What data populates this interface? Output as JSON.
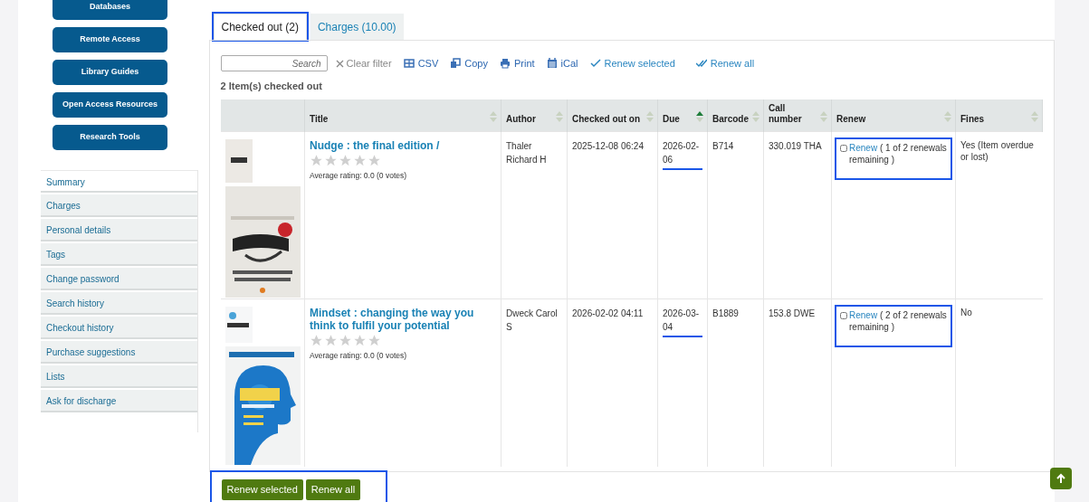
{
  "sidebar": {
    "buttons": [
      "Databases",
      "Remote Access",
      "Library Guides",
      "Open Access Resources",
      "Research Tools"
    ],
    "menu": [
      {
        "label": "Summary",
        "selected": true
      },
      {
        "label": "Charges",
        "selected": false
      },
      {
        "label": "Personal details",
        "selected": false
      },
      {
        "label": "Tags",
        "selected": false
      },
      {
        "label": "Change password",
        "selected": false
      },
      {
        "label": "Search history",
        "selected": false
      },
      {
        "label": "Checkout history",
        "selected": false
      },
      {
        "label": "Purchase suggestions",
        "selected": false
      },
      {
        "label": "Lists",
        "selected": false
      },
      {
        "label": "Ask for discharge",
        "selected": false
      }
    ]
  },
  "tabs": [
    {
      "label": "Checked out (2)",
      "selected": true,
      "highlighted": true
    },
    {
      "label": "Charges (10.00)",
      "selected": false,
      "highlighted": false
    }
  ],
  "toolbar": {
    "search": {
      "placeholder": "Search"
    },
    "clear_filter": "Clear filter",
    "actions": [
      {
        "kind": "csv",
        "label": "CSV"
      },
      {
        "kind": "copy",
        "label": "Copy"
      },
      {
        "kind": "print",
        "label": "Print"
      },
      {
        "kind": "ical",
        "label": "iCal"
      },
      {
        "kind": "renew-selected",
        "label": "Renew selected"
      },
      {
        "kind": "renew-all",
        "label": "Renew all"
      }
    ]
  },
  "summary": "2 Item(s) checked out",
  "table": {
    "columns": [
      {
        "label": "Title",
        "sorted_ascending": false
      },
      {
        "label": "Author",
        "sorted_ascending": false
      },
      {
        "label": "Checked out on",
        "sorted_ascending": false
      },
      {
        "label": "Due",
        "sorted_ascending": true
      },
      {
        "label": "Barcode",
        "sorted_ascending": false
      },
      {
        "label": "Call number",
        "sorted_ascending": false
      },
      {
        "label": "Renew",
        "sorted_ascending": false
      },
      {
        "label": "Fines",
        "sorted_ascending": false
      }
    ],
    "rows": [
      {
        "title": "Nudge : the final edition /",
        "stars": 0,
        "rating": "Average rating: 0.0 (0 votes)",
        "author": "Thaler Richard H",
        "checked_out_on": "2025-12-08 06:24",
        "due": "2026-02-06",
        "due_highlighted": true,
        "barcode": "B714",
        "call_number": "330.019 THA",
        "renew": {
          "checked": false,
          "link": "Renew",
          "note": "( 1 of 2 renewals remaining )",
          "highlighted": true
        },
        "fines": "Yes (Item overdue or lost)"
      },
      {
        "title": "Mindset : changing the way you think to fulfil your potential",
        "stars": 0,
        "rating": "Average rating: 0.0 (0 votes)",
        "author": "Dweck Carol S",
        "checked_out_on": "2026-02-02 04:11",
        "due": "2026-03-04",
        "due_highlighted": true,
        "barcode": "B1889",
        "call_number": "153.8 DWE",
        "renew": {
          "checked": false,
          "link": "Renew",
          "note": "( 2 of 2 renewals remaining )",
          "highlighted": true
        },
        "fines": "No"
      }
    ]
  },
  "bottom_buttons": {
    "labels": [
      "Renew selected",
      "Renew all"
    ],
    "highlighted": true
  }
}
